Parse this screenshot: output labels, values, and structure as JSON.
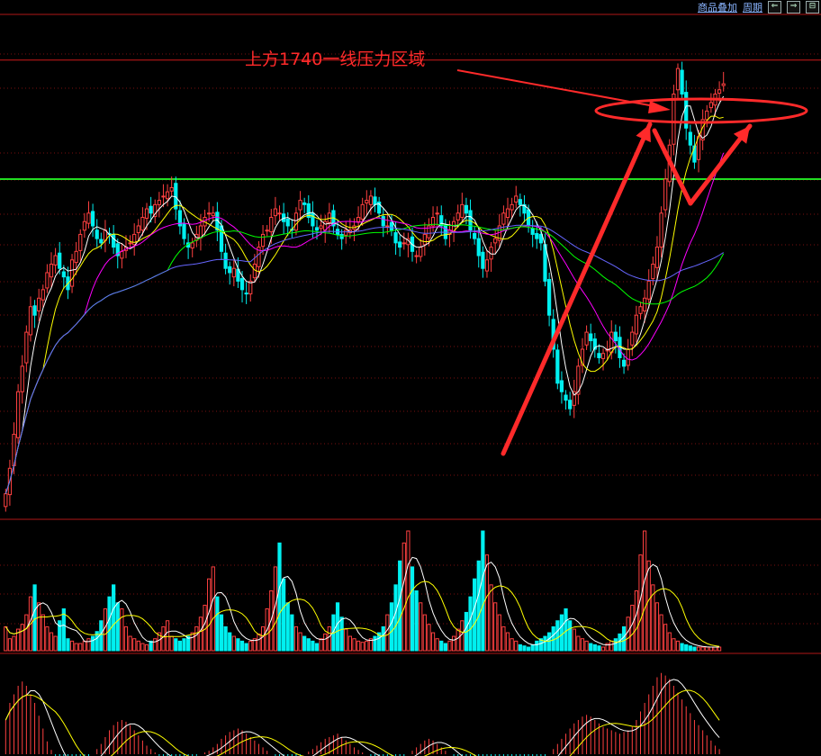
{
  "toolbar": {
    "overlay_label": "商品叠加",
    "period_label": "周期",
    "buttons": [
      "⇐",
      "⇒",
      "⊟"
    ]
  },
  "annotation": {
    "text": "上方1740一线压力区域"
  },
  "colors": {
    "up": "#ff4040",
    "down": "#00f0f0",
    "ma5": "#ffffff",
    "ma10": "#ffff00",
    "ma20": "#ff00ff",
    "ma40": "#00ff00",
    "ma60": "#6666ff",
    "support": "#22dd22",
    "resistance": "#ff2a2a",
    "grid": "#7a1010"
  },
  "chart_data": [
    {
      "type": "candlestick",
      "panel": "price",
      "ylim": [
        1200,
        1800
      ],
      "support_level": 1600,
      "resistance_level": 1740,
      "note_ranges": "closes estimated from screenshot, values in price units",
      "closes": [
        1230,
        1260,
        1300,
        1350,
        1380,
        1420,
        1450,
        1440,
        1460,
        1470,
        1490,
        1500,
        1510,
        1495,
        1485,
        1470,
        1505,
        1515,
        1535,
        1550,
        1560,
        1545,
        1530,
        1525,
        1540,
        1535,
        1520,
        1510,
        1515,
        1520,
        1525,
        1535,
        1545,
        1555,
        1565,
        1560,
        1570,
        1575,
        1580,
        1585,
        1590,
        1565,
        1545,
        1530,
        1520,
        1525,
        1535,
        1545,
        1555,
        1560,
        1560,
        1540,
        1515,
        1495,
        1490,
        1495,
        1480,
        1470,
        1465,
        1480,
        1500,
        1520,
        1535,
        1540,
        1555,
        1565,
        1560,
        1550,
        1545,
        1540,
        1560,
        1575,
        1570,
        1555,
        1545,
        1540,
        1545,
        1550,
        1560,
        1545,
        1535,
        1530,
        1540,
        1540,
        1545,
        1555,
        1570,
        1575,
        1580,
        1570,
        1560,
        1545,
        1545,
        1540,
        1525,
        1520,
        1525,
        1530,
        1515,
        1510,
        1520,
        1535,
        1545,
        1555,
        1560,
        1545,
        1530,
        1540,
        1550,
        1560,
        1570,
        1560,
        1540,
        1530,
        1510,
        1495,
        1505,
        1520,
        1530,
        1545,
        1560,
        1565,
        1570,
        1580,
        1570,
        1560,
        1545,
        1535,
        1530,
        1525,
        1480,
        1440,
        1400,
        1360,
        1350,
        1340,
        1330,
        1350,
        1380,
        1400,
        1420,
        1410,
        1400,
        1390,
        1395,
        1400,
        1420,
        1410,
        1390,
        1380,
        1400,
        1420,
        1440,
        1450,
        1460,
        1480,
        1500,
        1520,
        1560,
        1600,
        1640,
        1700,
        1730,
        1700,
        1660,
        1640,
        1620,
        1650,
        1670,
        1680,
        1690,
        1700,
        1705,
        1712
      ]
    },
    {
      "type": "bar",
      "panel": "volume",
      "note": "relative volume 0-100",
      "values": [
        20,
        10,
        12,
        18,
        22,
        30,
        45,
        55,
        40,
        30,
        20,
        15,
        12,
        25,
        35,
        10,
        8,
        6,
        6,
        8,
        10,
        12,
        16,
        25,
        35,
        45,
        55,
        40,
        35,
        20,
        12,
        10,
        8,
        6,
        5,
        8,
        10,
        15,
        20,
        25,
        12,
        10,
        8,
        10,
        12,
        15,
        20,
        28,
        38,
        60,
        70,
        45,
        30,
        20,
        15,
        12,
        10,
        8,
        6,
        8,
        10,
        14,
        20,
        35,
        50,
        70,
        90,
        60,
        40,
        30,
        20,
        15,
        12,
        10,
        8,
        6,
        10,
        14,
        20,
        30,
        40,
        28,
        18,
        12,
        10,
        8,
        7,
        8,
        10,
        12,
        15,
        20,
        30,
        40,
        55,
        75,
        90,
        100,
        70,
        50,
        40,
        30,
        22,
        15,
        10,
        8,
        6,
        8,
        12,
        18,
        25,
        32,
        45,
        60,
        75,
        100,
        80,
        55,
        40,
        30,
        20,
        15,
        10,
        8,
        5,
        4,
        3,
        5,
        8,
        10,
        12,
        15,
        20,
        25,
        30,
        35,
        25,
        18,
        12,
        10,
        8,
        6,
        5,
        4,
        3,
        6,
        8,
        10,
        14,
        20,
        28,
        38,
        50,
        80,
        100,
        75,
        55,
        40,
        30,
        22,
        15,
        10,
        8,
        6,
        5,
        4,
        3,
        3,
        3,
        3,
        3,
        3,
        3
      ]
    },
    {
      "type": "bar",
      "panel": "macd",
      "values": [
        40,
        60,
        70,
        80,
        85,
        80,
        70,
        60,
        45,
        30,
        15,
        5,
        -5,
        -12,
        -18,
        -22,
        -25,
        -20,
        -15,
        -10,
        -5,
        0,
        6,
        12,
        20,
        28,
        34,
        38,
        40,
        38,
        34,
        28,
        22,
        16,
        10,
        6,
        2,
        -2,
        -5,
        -8,
        -10,
        -12,
        -10,
        -8,
        -6,
        -4,
        -2,
        0,
        2,
        4,
        8,
        12,
        18,
        22,
        26,
        28,
        30,
        28,
        24,
        20,
        16,
        12,
        8,
        4,
        0,
        -4,
        -8,
        -10,
        -12,
        -10,
        -8,
        -4,
        0,
        3,
        6,
        10,
        14,
        18,
        20,
        22,
        24,
        20,
        16,
        12,
        8,
        5,
        2,
        0,
        -3,
        -6,
        -9,
        -12,
        -15,
        -12,
        -9,
        -6,
        -3,
        0,
        4,
        8,
        12,
        16,
        18,
        16,
        12,
        8,
        4,
        0,
        -4,
        -8,
        -12,
        -14,
        -16,
        -18,
        -16,
        -14,
        -12,
        -10,
        -8,
        -12,
        -16,
        -22,
        -28,
        -30,
        -32,
        -30,
        -26,
        -22,
        -18,
        -12,
        -6,
        0,
        6,
        12,
        18,
        24,
        30,
        36,
        40,
        44,
        46,
        44,
        40,
        36,
        32,
        30,
        28,
        26,
        24,
        26,
        28,
        32,
        40,
        50,
        60,
        70,
        80,
        90,
        95,
        92,
        88,
        80,
        72,
        64,
        56,
        48,
        40,
        34,
        28,
        22,
        16,
        10,
        6
      ]
    }
  ]
}
